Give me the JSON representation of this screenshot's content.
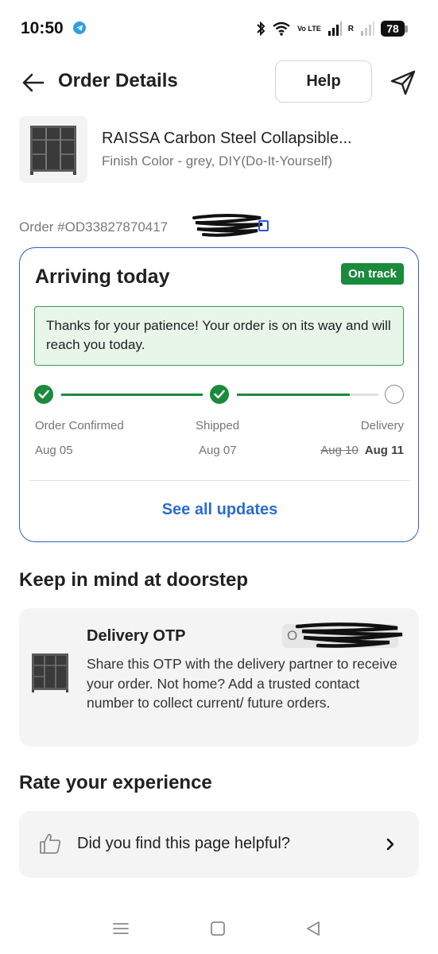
{
  "status_bar": {
    "time": "10:50",
    "battery": "78",
    "network_label": "Vo LTE",
    "roaming_label": "R"
  },
  "header": {
    "title": "Order Details",
    "help_label": "Help"
  },
  "product": {
    "name": "RAISSA Carbon Steel Collapsible...",
    "variant": "Finish Color - grey, DIY(Do-It-Yourself)"
  },
  "order": {
    "id_text": "Order #OD33827870417"
  },
  "delivery_card": {
    "title": "Arriving today",
    "badge": "On track",
    "message": "Thanks for your patience! Your order is on its way and will reach you today.",
    "steps": [
      {
        "label": "Order Confirmed",
        "date": "Aug 05",
        "status": "done"
      },
      {
        "label": "Shipped",
        "date": "Aug 07",
        "status": "done"
      },
      {
        "label": "Delivery",
        "old_date": "Aug 10",
        "date": "Aug 11",
        "status": "pending"
      }
    ],
    "progress_segment_2_fraction": 0.8,
    "see_all_label": "See all updates"
  },
  "doorstep": {
    "section_title": "Keep in mind at doorstep",
    "otp_title": "Delivery OTP",
    "otp_chip": "O",
    "otp_description": "Share this OTP with the delivery partner to receive your order. Not home? Add a trusted contact number to collect current/ future orders."
  },
  "rating": {
    "section_title": "Rate your experience",
    "question": "Did you find this page helpful?"
  },
  "colors": {
    "accent_blue": "#2a6bd6",
    "success_green": "#1a8b3c",
    "card_border": "#2f5fc1"
  }
}
